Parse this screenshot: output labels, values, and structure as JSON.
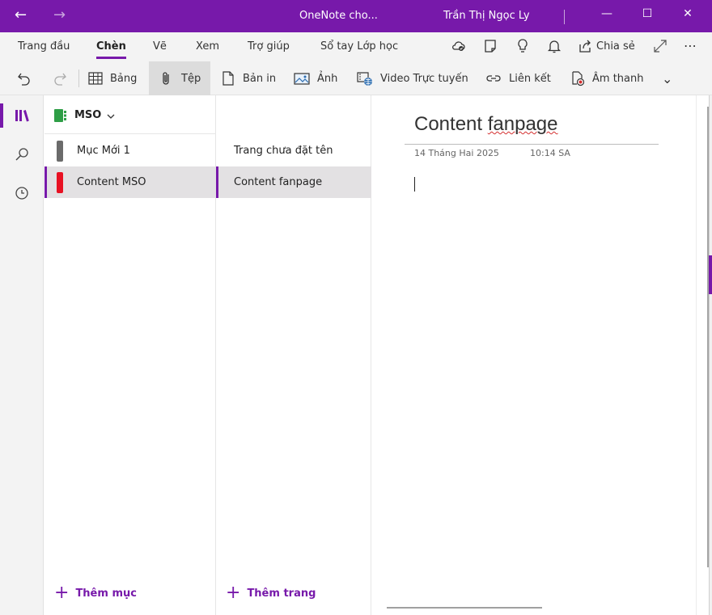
{
  "window": {
    "title": "OneNote cho...",
    "user": "Trần Thị Ngọc Ly",
    "back_glyph": "←",
    "forward_glyph": "→",
    "minimize_glyph": "—",
    "maximize_glyph": "☐",
    "close_glyph": "✕"
  },
  "tabs": [
    "Trang đầu",
    "Chèn",
    "Vẽ",
    "Xem",
    "Trợ giúp",
    "Sổ tay Lớp học"
  ],
  "active_tab": "Chèn",
  "tab_tools": {
    "share_label": "Chia sẻ",
    "more_glyph": "⋯"
  },
  "toolbar": {
    "table_label": "Bảng",
    "file_label": "Tệp",
    "printout_label": "Bản in",
    "picture_label": "Ảnh",
    "online_video_label": "Video Trực tuyến",
    "link_label": "Liên kết",
    "audio_label": "Âm thanh",
    "more_glyph": "⌄"
  },
  "notebook": {
    "name": "MSO",
    "color": "#2e9e46"
  },
  "sections": [
    {
      "label": "Mục Mới 1",
      "color": "#6b6b6b",
      "selected": false
    },
    {
      "label": "Content MSO",
      "color": "#e81123",
      "selected": true
    }
  ],
  "pages": [
    {
      "label": "Trang chưa đặt tên",
      "selected": false
    },
    {
      "label": "Content fanpage",
      "selected": true
    }
  ],
  "add_section_label": "Thêm mục",
  "add_page_label": "Thêm trang",
  "page": {
    "title_plain": "Content ",
    "title_misspelled": "fanpage",
    "date": "14 Tháng Hai 2025",
    "time": "10:14 SA"
  },
  "colors": {
    "accent": "#7719aa",
    "ribbon_bg": "#f3f3f3"
  }
}
